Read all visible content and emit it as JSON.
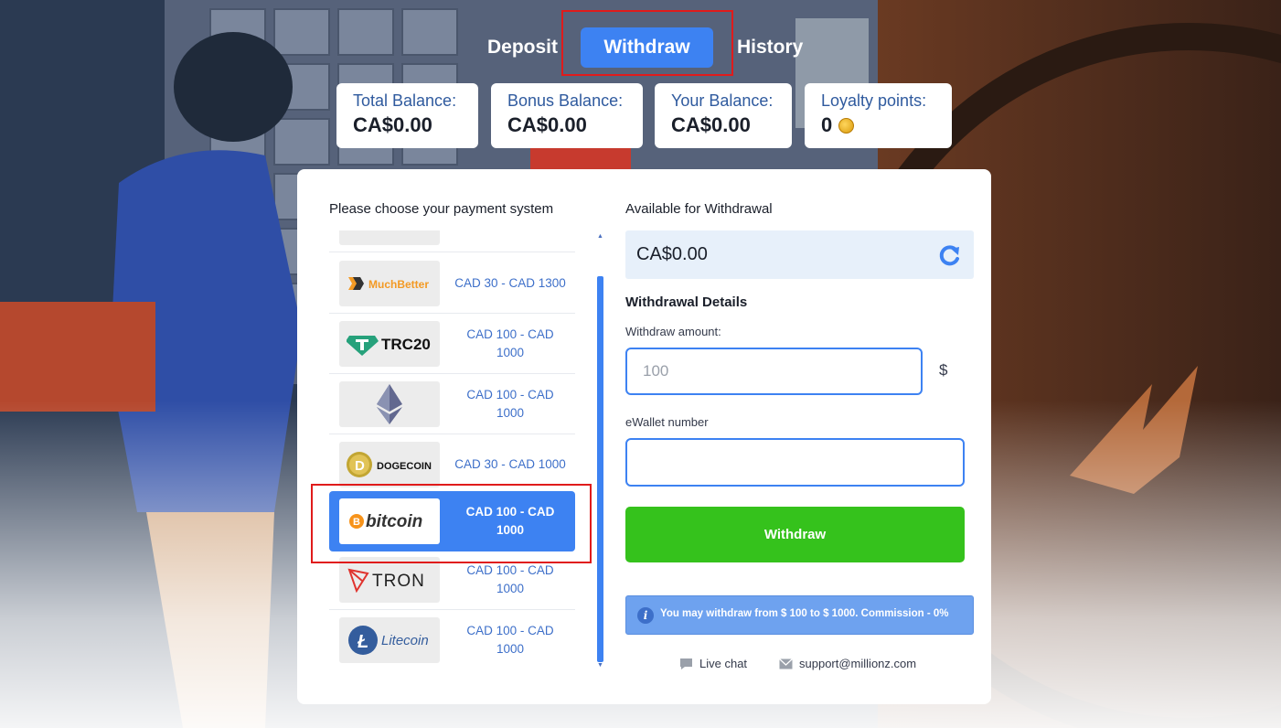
{
  "tabs": [
    {
      "label": "Deposit",
      "active": false
    },
    {
      "label": "Withdraw",
      "active": true
    },
    {
      "label": "History",
      "active": false
    }
  ],
  "balances": {
    "total": {
      "label": "Total Balance:",
      "value": "CA$0.00"
    },
    "bonus": {
      "label": "Bonus Balance:",
      "value": "CA$0.00"
    },
    "yours": {
      "label": "Your Balance:",
      "value": "CA$0.00"
    },
    "loyalty": {
      "label": "Loyalty points:",
      "value": "0",
      "icon": "gold-coin-icon"
    }
  },
  "payment": {
    "title": "Please choose your payment system",
    "methods": [
      {
        "name": "muchbetter",
        "logo_text": "MuchBetter",
        "range_line1": "CAD 30 - CAD 1300",
        "range_line2": "",
        "selected": false
      },
      {
        "name": "trc20",
        "logo_text": "TRC20",
        "range_line1": "CAD 100 - CAD",
        "range_line2": "1000",
        "selected": false
      },
      {
        "name": "ethereum",
        "logo_text": "",
        "range_line1": "CAD 100 - CAD",
        "range_line2": "1000",
        "selected": false
      },
      {
        "name": "dogecoin",
        "logo_text": "DOGECOIN",
        "range_line1": "CAD 30 - CAD 1000",
        "range_line2": "",
        "selected": false
      },
      {
        "name": "bitcoin",
        "logo_text": "bitcoin",
        "range_line1": "CAD 100 - CAD",
        "range_line2": "1000",
        "selected": true
      },
      {
        "name": "tron",
        "logo_text": "TRON",
        "range_line1": "CAD 100 - CAD",
        "range_line2": "1000",
        "selected": false
      },
      {
        "name": "litecoin",
        "logo_text": "Litecoin",
        "range_line1": "CAD 100 - CAD",
        "range_line2": "1000",
        "selected": false
      }
    ]
  },
  "withdrawal": {
    "available_title": "Available for Withdrawal",
    "available_value": "CA$0.00",
    "details_title": "Withdrawal Details",
    "amount_label": "Withdraw amount:",
    "amount_placeholder": "100",
    "currency_symbol": "$",
    "wallet_label": "eWallet number",
    "wallet_value": "",
    "button_label": "Withdraw",
    "info_text": "You may withdraw from $ 100 to $ 1000. Commission - 0%"
  },
  "footer": {
    "live_chat": "Live chat",
    "email": "support@millionz.com"
  },
  "colors": {
    "accent": "#3d82f2",
    "success": "#35c21c",
    "highlight": "#e01b1b",
    "label_blue": "#2f5a9e"
  }
}
